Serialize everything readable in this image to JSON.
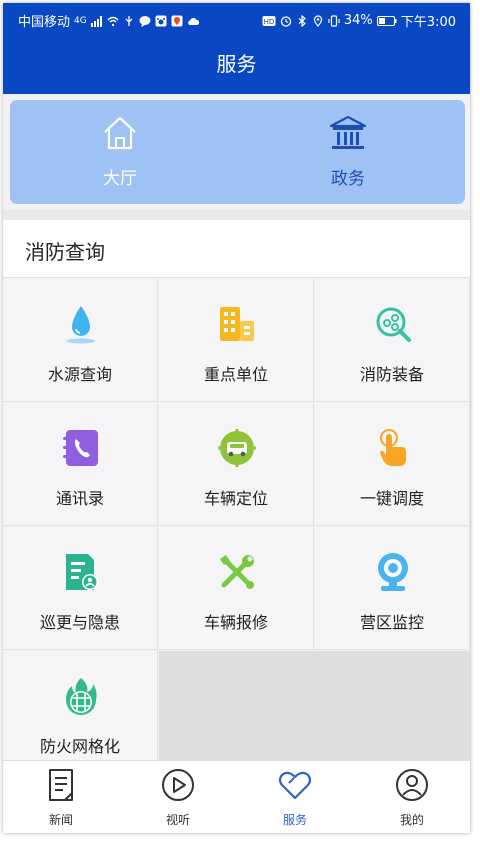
{
  "status_bar": {
    "carrier": "中国移动",
    "network": "4G",
    "battery": "34%",
    "time": "下午3:00"
  },
  "header": {
    "title": "服务"
  },
  "top_tabs": [
    {
      "label": "大厅",
      "icon": "home-icon"
    },
    {
      "label": "政务",
      "icon": "government-building-icon"
    }
  ],
  "section": {
    "title": "消防查询"
  },
  "grid_items": [
    {
      "label": "水源查询",
      "icon": "water-drop-icon"
    },
    {
      "label": "重点单位",
      "icon": "buildings-icon"
    },
    {
      "label": "消防装备",
      "icon": "equipment-search-icon"
    },
    {
      "label": "通讯录",
      "icon": "phone-book-icon"
    },
    {
      "label": "车辆定位",
      "icon": "vehicle-location-icon"
    },
    {
      "label": "一键调度",
      "icon": "tap-hand-icon"
    },
    {
      "label": "巡更与隐患",
      "icon": "patrol-document-icon"
    },
    {
      "label": "车辆报修",
      "icon": "wrench-tools-icon"
    },
    {
      "label": "营区监控",
      "icon": "camera-icon"
    },
    {
      "label": "防火网格化",
      "icon": "fire-grid-icon"
    }
  ],
  "bottom_nav": [
    {
      "label": "新闻",
      "icon": "news-icon",
      "active": false
    },
    {
      "label": "视听",
      "icon": "play-icon",
      "active": false
    },
    {
      "label": "服务",
      "icon": "heart-icon",
      "active": true
    },
    {
      "label": "我的",
      "icon": "user-icon",
      "active": false
    }
  ],
  "colors": {
    "primary": "#0a47c2",
    "tab_panel": "#9fc2f4",
    "active_nav": "#2c63c9"
  }
}
